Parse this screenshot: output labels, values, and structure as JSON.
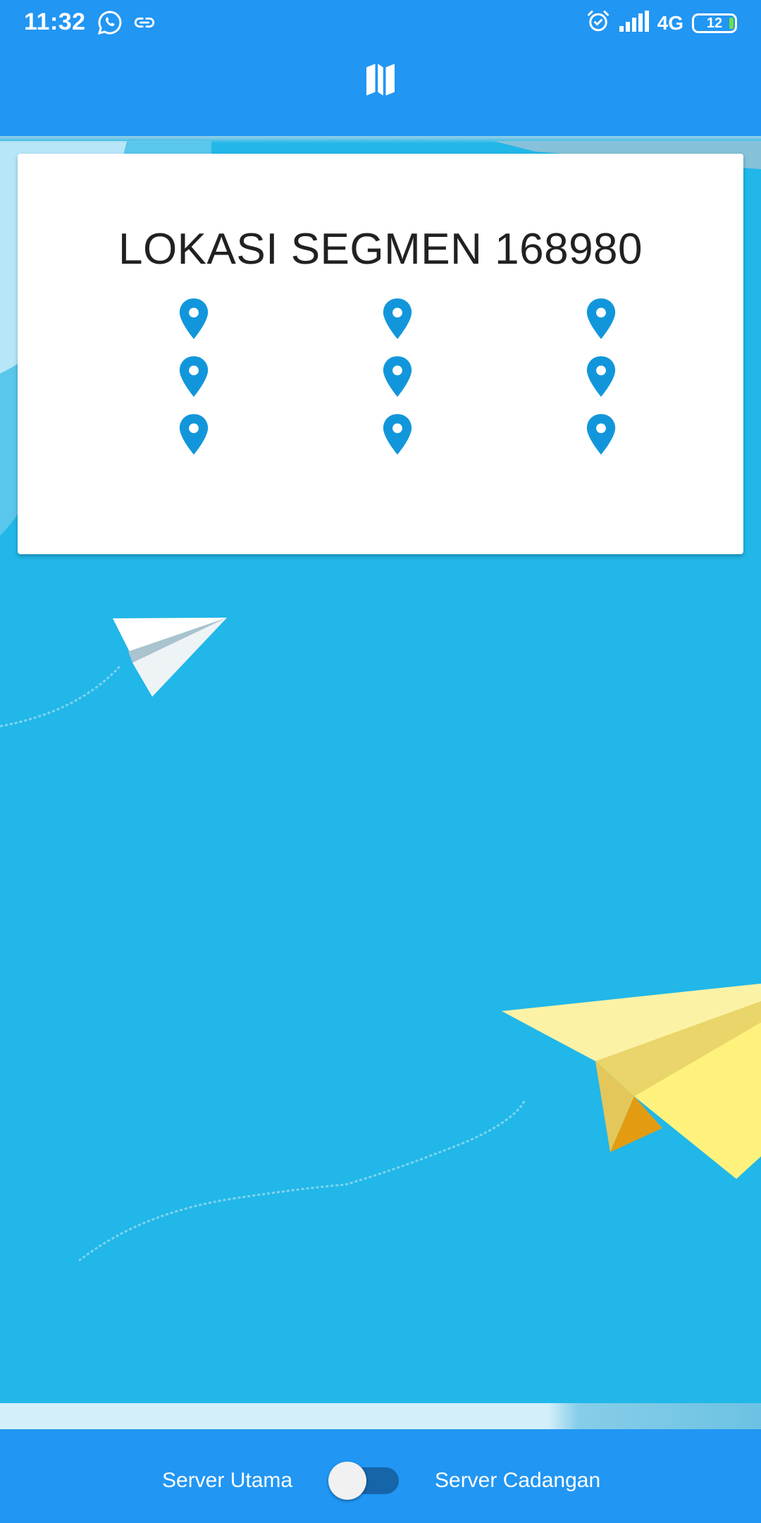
{
  "status_bar": {
    "time": "11:32",
    "left_icons": [
      "whatsapp-icon",
      "link-icon"
    ],
    "right_icons": [
      "alarm-icon",
      "signal-icon"
    ],
    "network": "4G",
    "battery": "12"
  },
  "app_bar": {
    "icon": "map-icon"
  },
  "card": {
    "title": "LOKASI SEGMEN 168980",
    "pins": [
      "location-pin-icon",
      "location-pin-icon",
      "location-pin-icon",
      "location-pin-icon",
      "location-pin-icon",
      "location-pin-icon",
      "location-pin-icon",
      "location-pin-icon",
      "location-pin-icon"
    ],
    "pin_color": "#1296db"
  },
  "bottom_bar": {
    "left_label": "Server Utama",
    "right_label": "Server Cadangan",
    "toggle_on": false
  },
  "colors": {
    "primary": "#2196f3",
    "background": "#21b7e8"
  }
}
